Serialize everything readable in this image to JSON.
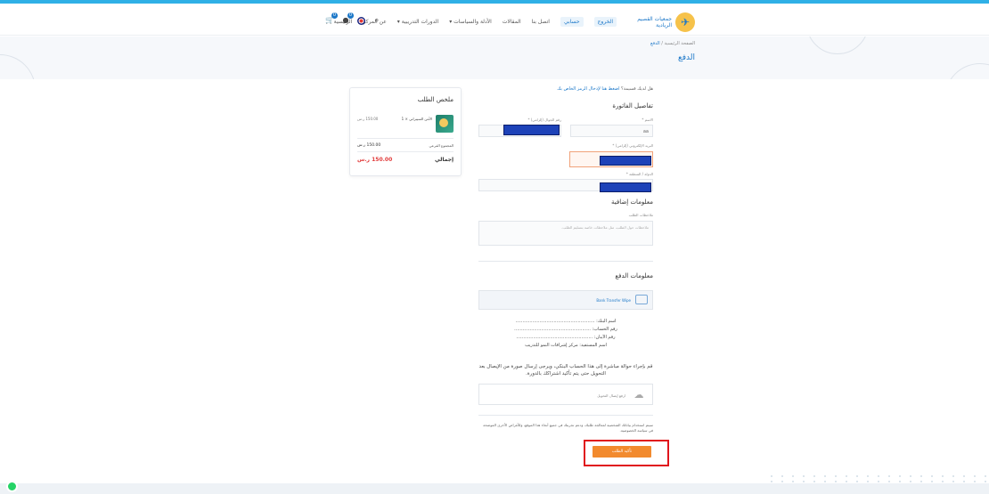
{
  "header": {
    "logo_text": "جمعيات القصيم الريادية",
    "nav": [
      "الرئيسية",
      "عن المركز",
      "الدورات التدريبية ▾",
      "الأدلة والسياسات ▾",
      "المقالات",
      "اتصل بنا",
      "حسابي",
      "الخروج"
    ],
    "cart_count": "0",
    "wishlist_count": "0"
  },
  "page": {
    "breadcrumb_home": "الصفحة الرئيسية",
    "breadcrumb_sep": "/",
    "breadcrumb_current": "الدفع",
    "title": "الدفع"
  },
  "form": {
    "coupon_text": "هل لديك قسيمة؟",
    "coupon_link": "اضغط هنا لإدخال الرمز الخاص بك",
    "billing_title": "تفاصيل الفاتورة",
    "first_name_label": "الاسم *",
    "first_name_value": "aa",
    "phone_label": "رقم الجوال (إلزامي) *",
    "email_label": "البريد الإلكتروني (إلزامي) *",
    "country_label": "الدولة / المنطقة *",
    "country_value": "",
    "additional_title": "معلومات إضافية",
    "notes_label": "ملاحظات الطلب",
    "notes_placeholder": "ملاحظات حول الطلب، مثل ملاحظات خاصة بتسليم الطلب.",
    "payment_title": "معلومات الدفع",
    "payment_method": "Bank Transfer Wipe",
    "bank_lines": [
      "اسم البنك: ........................................................",
      "رقم الحساب: ......................................................",
      "رقم الآيبان: ......................................................",
      "اسم المستفيد: مركز إشراقات النمو للتدريب"
    ],
    "note": "قم بإجراء حوالة مباشرة إلى هذا الحساب البنكي، ويرجى إرسال صورة من الإيصال بعد التحويل حتى يتم تأكيد اشتراكك بالدورة.",
    "upload_label": "ارفع إيصال التحويل",
    "terms": "سيتم استخدام بياناتك الشخصية لمعالجة طلبك، ودعم تجربتك في جميع أنحاء هذا الموقع، وللأغراض الأخرى الموضحة في سياسة الخصوصية.",
    "place_order": "تأكيد الطلب"
  },
  "summary": {
    "title": "ملخص الطلب",
    "item_name": "الأمن السيبراني × 1",
    "item_price": "150.00 ر.س",
    "subtotal_label": "المجموع الفرعي",
    "subtotal_value": "150.00 ر.س",
    "total_label": "إجمالي",
    "total_value": "150.00 ر.س"
  },
  "colors": {
    "accent": "#1b77c8",
    "button": "#f28a2e",
    "highlight": "#e0141b",
    "total": "#e13b3b"
  }
}
